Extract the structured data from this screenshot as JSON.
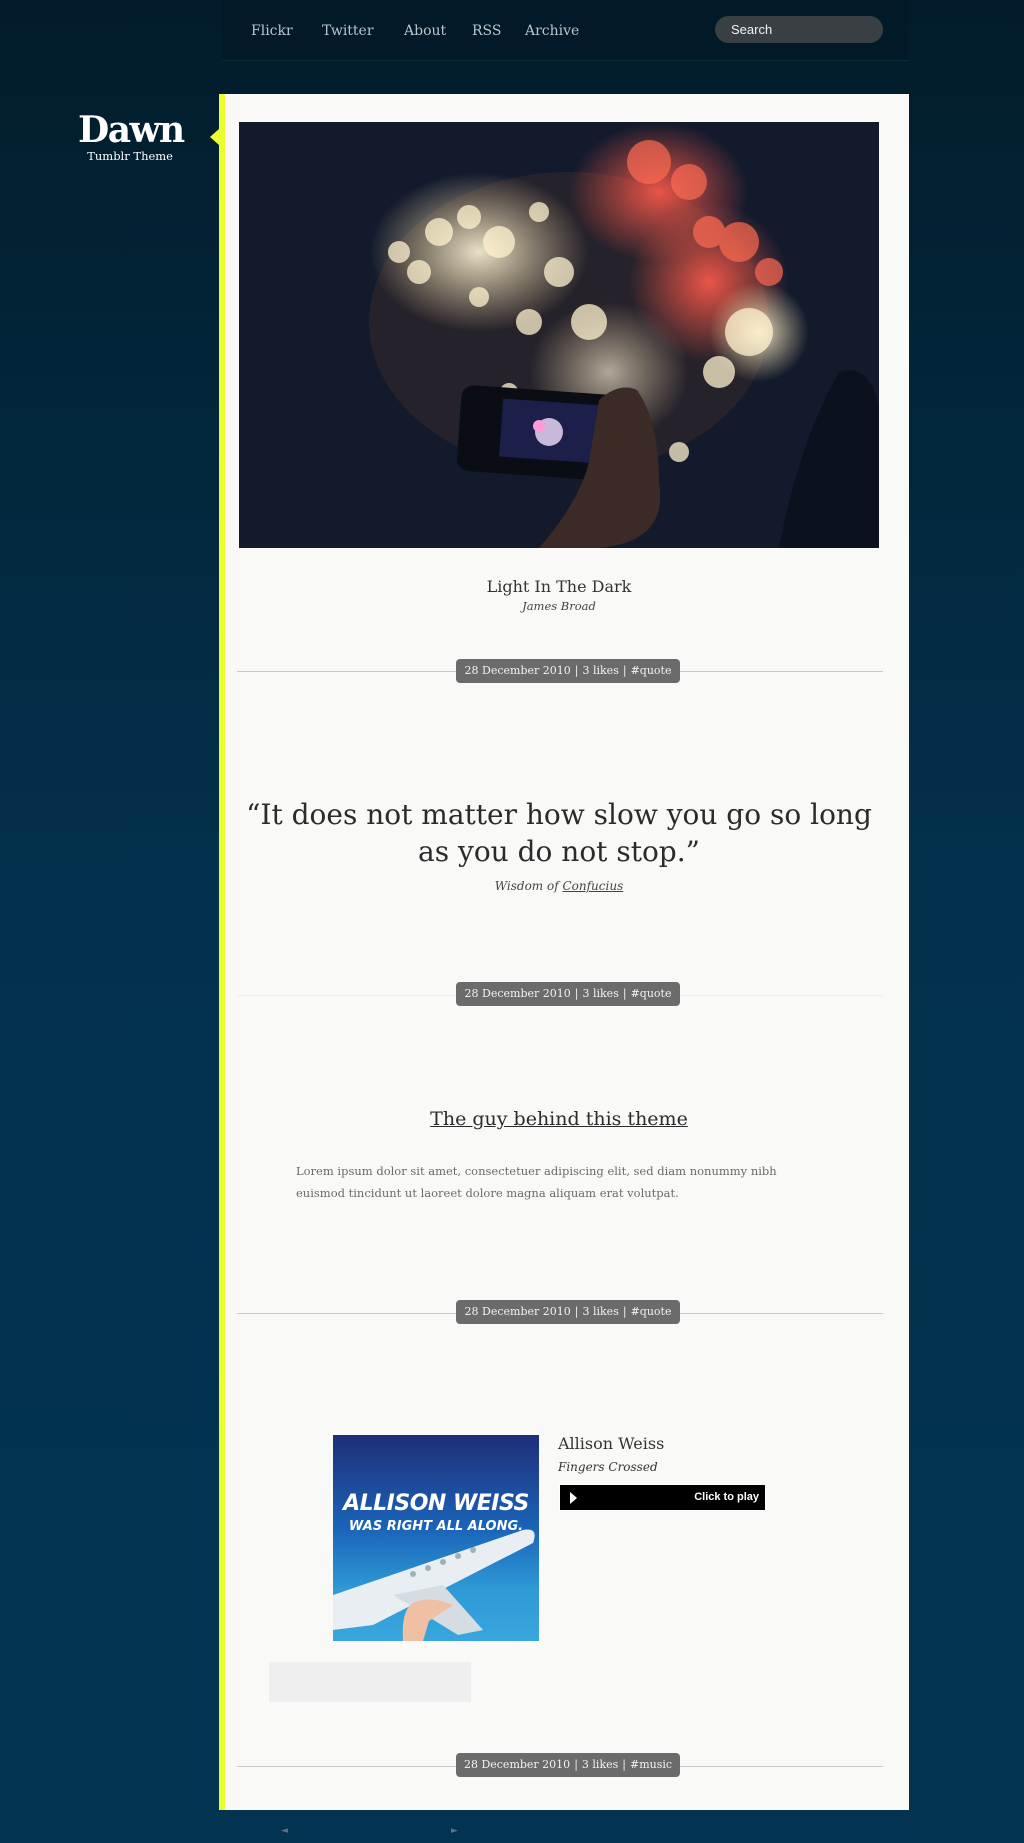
{
  "nav": {
    "links": [
      "Flickr",
      "Twitter",
      "About",
      "RSS",
      "Archive"
    ],
    "search_placeholder": "Search"
  },
  "blog": {
    "title": "Dawn",
    "subtitle": "Tumblr Theme",
    "accent_color": "#e9ff2e"
  },
  "posts": {
    "photo": {
      "caption_title": "Light In The Dark",
      "caption_author": "James Broad",
      "meta": {
        "date": "28 December 2010",
        "likes": "3 likes",
        "tag": "#quote"
      }
    },
    "quote": {
      "text": "“It does not matter how slow you go so long as you do not stop.”",
      "source_prefix": "Wisdom of",
      "source_link": "Confucius",
      "meta": {
        "date": "28 December 2010",
        "likes": "3 likes",
        "tag": "#quote"
      }
    },
    "text": {
      "title": "The guy behind this theme",
      "body": "Lorem ipsum dolor sit amet, consectetuer adipiscing elit, sed diam nonummy nibh euismod tincidunt ut laoreet dolore magna aliquam erat volutpat.",
      "meta": {
        "date": "28 December 2010",
        "likes": "3 likes",
        "tag": "#quote"
      }
    },
    "audio": {
      "artist": "Allison Weiss",
      "track": "Fingers Crossed",
      "album_art_artist": "ALLISON WEISS",
      "album_art_title": "WAS RIGHT ALL ALONG.",
      "player_label": "Click to play",
      "meta": {
        "date": "28 December 2010",
        "likes": "3 likes",
        "tag": "#music"
      }
    }
  },
  "pagination": {
    "prev": "◄",
    "next": "►"
  }
}
